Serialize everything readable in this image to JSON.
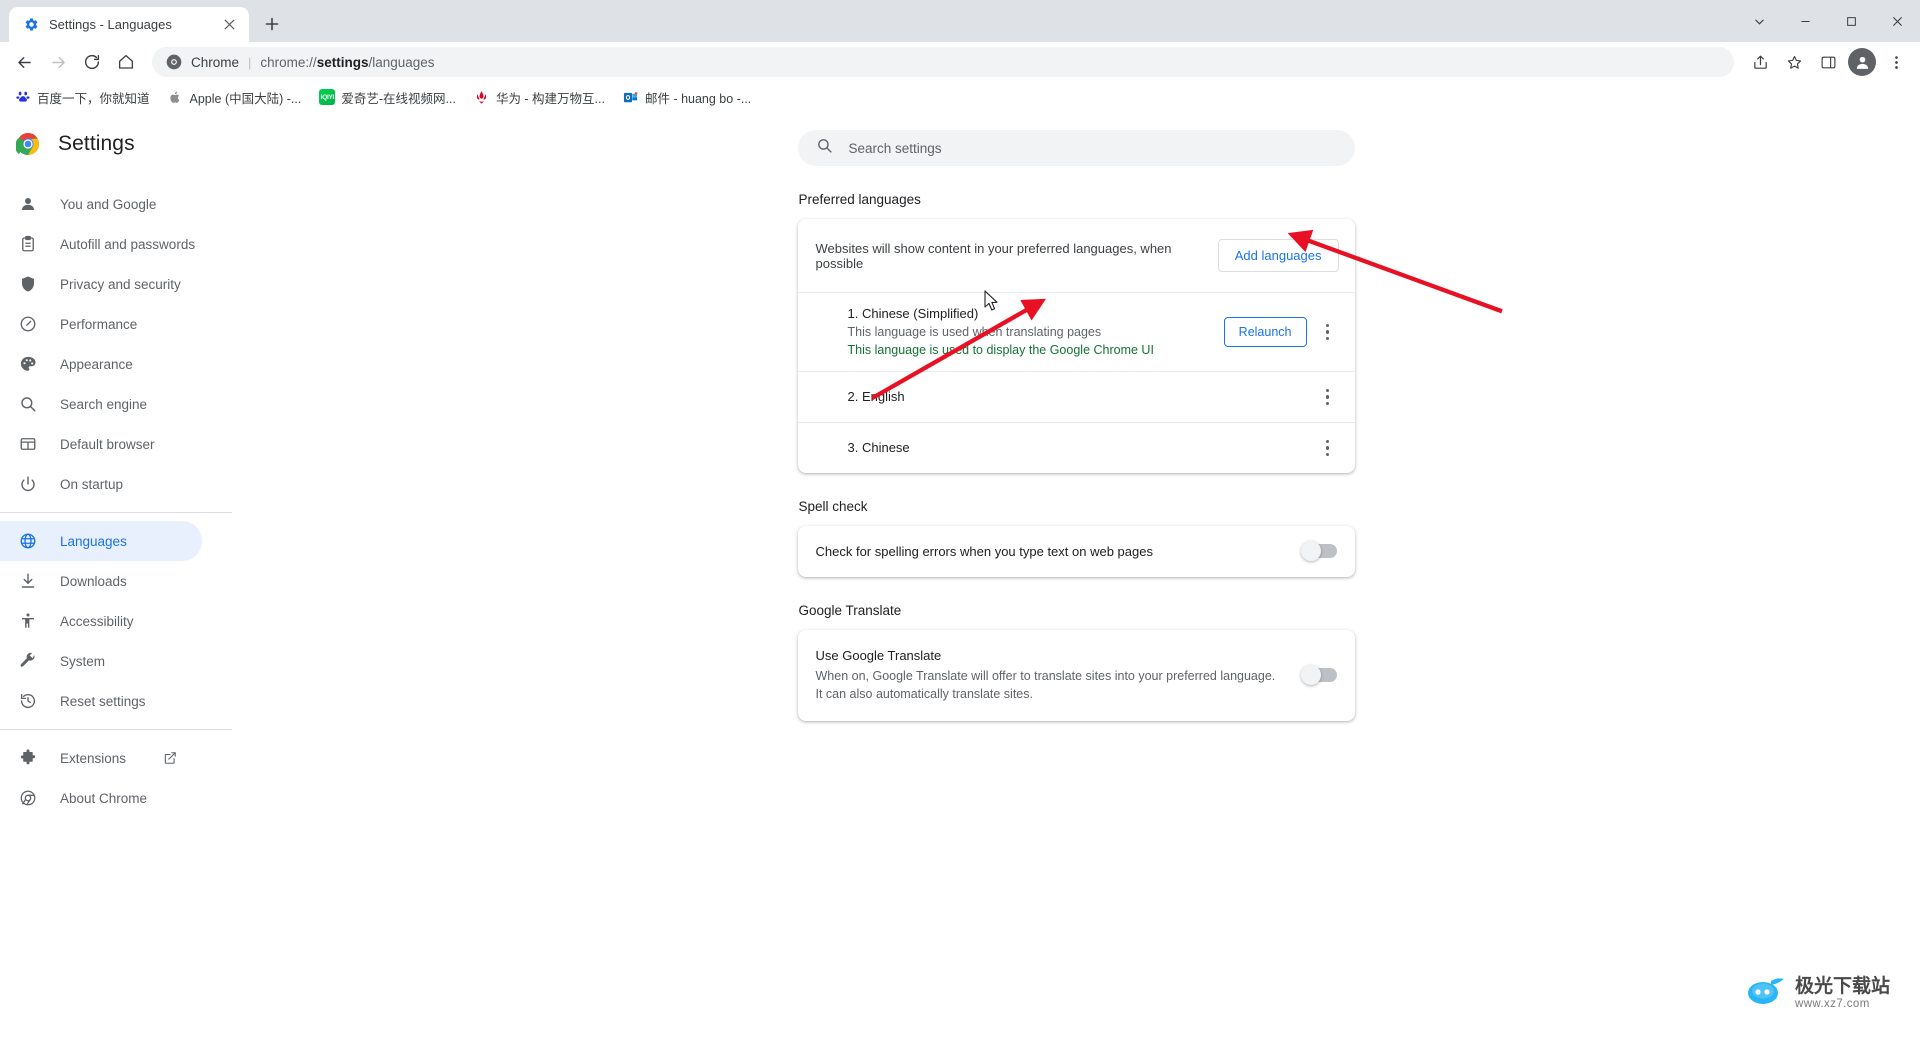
{
  "window": {
    "tab": {
      "title": "Settings - Languages",
      "favicon_icon": "gear-icon",
      "close_icon": "close-icon"
    },
    "new_tab_icon": "plus-icon",
    "controls": {
      "list_all_tabs_icon": "chevron-down-icon",
      "minimize_icon": "minimize-icon",
      "maximize_icon": "maximize-icon",
      "close_icon": "window-close-icon"
    }
  },
  "toolbar": {
    "back_icon": "back-arrow-icon",
    "forward_icon": "forward-arrow-icon",
    "reload_icon": "reload-icon",
    "home_icon": "home-icon",
    "omnibox": {
      "site_icon": "chrome-icon",
      "site_label": "Chrome",
      "separator": "|",
      "url_prefix": "chrome://",
      "url_bold": "settings",
      "url_suffix": "/languages",
      "share_icon": "share-icon",
      "bookmark_icon": "star-icon"
    },
    "side_panel_icon": "side-panel-icon",
    "profile_icon": "avatar-icon",
    "menu_icon": "three-dot-menu-icon"
  },
  "bookmarks": [
    {
      "label": "百度一下，你就知道",
      "icon": "baidu-icon",
      "color": "#2932e1"
    },
    {
      "label": "Apple (中国大陆) -...",
      "icon": "apple-icon",
      "color": "#8e8e93"
    },
    {
      "label": "爱奇艺-在线视频网...",
      "icon": "iqiyi-icon",
      "color": "#00be06"
    },
    {
      "label": "华为 - 构建万物互...",
      "icon": "huawei-icon",
      "color": "#cf0a2c"
    },
    {
      "label": "邮件 - huang bo -...",
      "icon": "outlook-icon",
      "color": "#0f6cbd"
    }
  ],
  "sidebar": {
    "brand": {
      "logo_icon": "chrome-logo-icon",
      "title": "Settings"
    },
    "items": [
      {
        "label": "You and Google",
        "icon": "person-icon",
        "active": false
      },
      {
        "label": "Autofill and passwords",
        "icon": "clipboard-icon",
        "active": false
      },
      {
        "label": "Privacy and security",
        "icon": "shield-icon",
        "active": false
      },
      {
        "label": "Performance",
        "icon": "speedometer-icon",
        "active": false
      },
      {
        "label": "Appearance",
        "icon": "palette-icon",
        "active": false
      },
      {
        "label": "Search engine",
        "icon": "search-icon",
        "active": false
      },
      {
        "label": "Default browser",
        "icon": "browser-window-icon",
        "active": false
      },
      {
        "label": "On startup",
        "icon": "power-icon",
        "active": false
      }
    ],
    "items_group2": [
      {
        "label": "Languages",
        "icon": "globe-icon",
        "active": true
      },
      {
        "label": "Downloads",
        "icon": "download-icon",
        "active": false
      },
      {
        "label": "Accessibility",
        "icon": "accessibility-icon",
        "active": false
      },
      {
        "label": "System",
        "icon": "wrench-icon",
        "active": false
      },
      {
        "label": "Reset settings",
        "icon": "history-restore-icon",
        "active": false
      }
    ],
    "items_group3": [
      {
        "label": "Extensions",
        "icon": "puzzle-icon",
        "external": true,
        "external_icon": "external-link-icon",
        "active": false
      },
      {
        "label": "About Chrome",
        "icon": "chrome-outline-icon",
        "external": false,
        "active": false
      }
    ]
  },
  "search": {
    "icon": "search-icon",
    "placeholder": "Search settings",
    "value": ""
  },
  "preferred_languages": {
    "section_title": "Preferred languages",
    "description": "Websites will show content in your preferred languages, when possible",
    "add_button": "Add languages",
    "languages": [
      {
        "name": "1. Chinese (Simplified)",
        "sub1": "This language is used when translating pages",
        "sub2": "This language is used to display the Google Chrome UI",
        "has_relaunch": true,
        "relaunch_label": "Relaunch",
        "menu_icon": "kebab-menu-icon"
      },
      {
        "name": "2. English",
        "sub1": "",
        "sub2": "",
        "has_relaunch": false,
        "relaunch_label": "",
        "menu_icon": "kebab-menu-icon"
      },
      {
        "name": "3. Chinese",
        "sub1": "",
        "sub2": "",
        "has_relaunch": false,
        "relaunch_label": "",
        "menu_icon": "kebab-menu-icon"
      }
    ]
  },
  "spell_check": {
    "section_title": "Spell check",
    "row_label": "Check for spelling errors when you type text on web pages",
    "toggle_state": "off"
  },
  "google_translate": {
    "section_title": "Google Translate",
    "row_title": "Use Google Translate",
    "row_desc": "When on, Google Translate will offer to translate sites into your preferred language. It can also automatically translate sites.",
    "toggle_state": "off"
  },
  "annotations": {
    "arrow_color": "#e81123",
    "count": 2
  },
  "watermark": {
    "main": "极光下载站",
    "sub": "www.xz7.com",
    "icon": "aurora-logo-icon"
  },
  "colors": {
    "accent": "#1a73e8",
    "accent_bg": "#e8f0fe",
    "green": "#137333",
    "text_primary": "#202124",
    "text_secondary": "#5f6368",
    "toolbar_bg": "#dee1e6"
  }
}
